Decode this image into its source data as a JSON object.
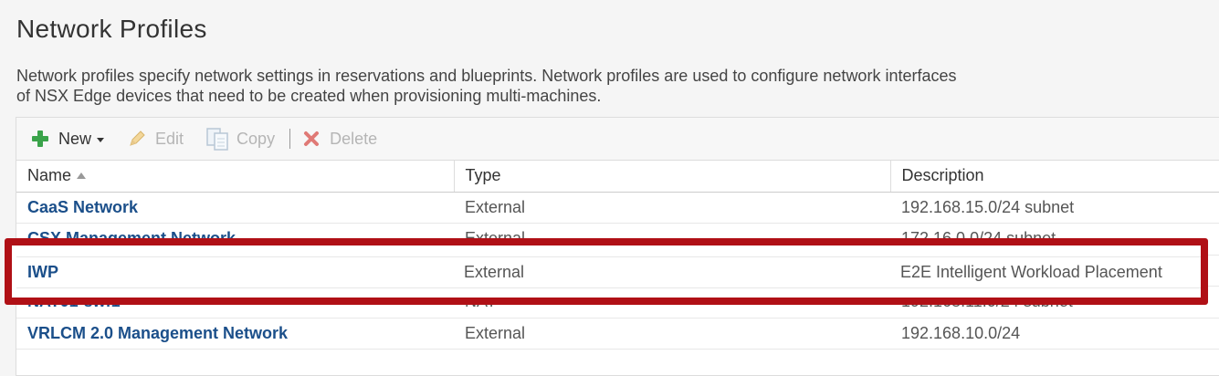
{
  "page": {
    "title": "Network Profiles",
    "description_line1": "Network profiles specify network settings in reservations and blueprints. Network profiles are used to configure network interfaces ",
    "description_line2": "of NSX Edge devices that need to be created when provisioning multi-machines."
  },
  "toolbar": {
    "new_label": "New",
    "edit_label": "Edit",
    "copy_label": "Copy",
    "delete_label": "Delete"
  },
  "table": {
    "columns": [
      "Name",
      "Type",
      "Description"
    ],
    "rows": [
      {
        "name": "CaaS Network",
        "type": "External",
        "description": "192.168.15.0/24 subnet"
      },
      {
        "name": "CSX Management Network",
        "type": "External",
        "description": "172.16.0.0/24 subnet"
      },
      {
        "name": "IWP",
        "type": "External",
        "description": "E2E Intelligent Workload Placement"
      },
      {
        "name": "NAT01-swf1",
        "type": "NAT",
        "description": "192.168.11.0/24 subnet"
      },
      {
        "name": "VRLCM 2.0 Management Network",
        "type": "External",
        "description": "192.168.10.0/24"
      }
    ]
  },
  "colors": {
    "highlight_border": "#b01016",
    "link": "#1b4f8a",
    "new_icon": "#3aa34a",
    "delete_icon": "#d9534f"
  }
}
